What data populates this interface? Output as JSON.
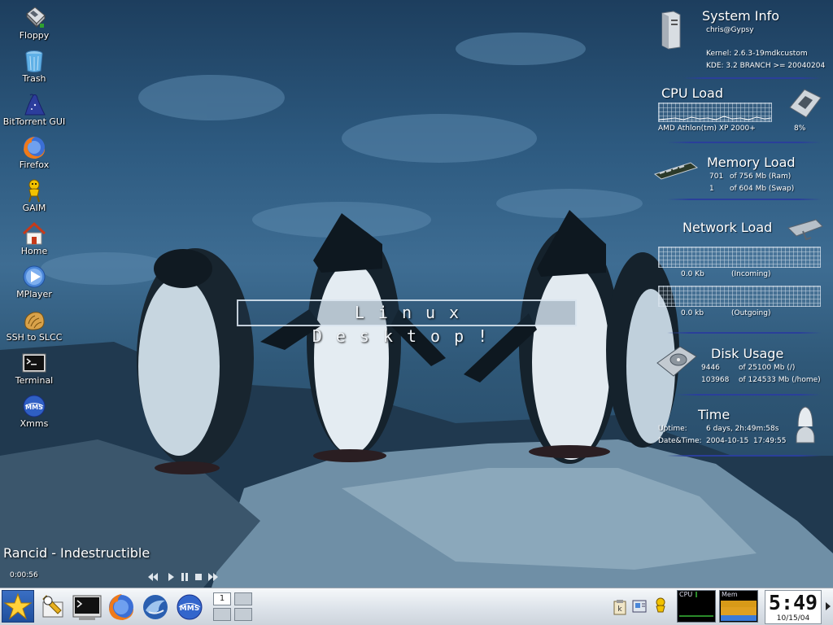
{
  "desktop": {
    "icons": [
      {
        "label": "Floppy",
        "icon": "floppy-icon"
      },
      {
        "label": "Trash",
        "icon": "trash-icon"
      },
      {
        "label": "BitTorrent GUI",
        "icon": "bittorrent-icon"
      },
      {
        "label": "Firefox",
        "icon": "firefox-icon"
      },
      {
        "label": "GAIM",
        "icon": "gaim-icon"
      },
      {
        "label": "Home",
        "icon": "home-icon"
      },
      {
        "label": "MPlayer",
        "icon": "mplayer-icon"
      },
      {
        "label": "SSH to SLCC",
        "icon": "shell-icon"
      },
      {
        "label": "Terminal",
        "icon": "terminal-icon"
      },
      {
        "label": "Xmms",
        "icon": "xmms-icon"
      }
    ],
    "banner": "Linux Desktop!"
  },
  "monitor": {
    "system": {
      "title": "System Info",
      "user": "chris@Gypsy",
      "kernel": "Kernel: 2.6.3-19mdkcustom",
      "kde": "KDE: 3.2 BRANCH >= 20040204"
    },
    "cpu": {
      "title": "CPU Load",
      "model": "AMD Athlon(tm) XP 2000+",
      "percent_text": "8%",
      "load_fraction": 0.08
    },
    "memory": {
      "title": "Memory Load",
      "ram_used": "701",
      "ram_total": "of 756 Mb (Ram)",
      "swap_used": "1",
      "swap_total": "of 604 Mb (Swap)"
    },
    "network": {
      "title": "Network Load",
      "in_value": "0.0 Kb",
      "in_label": "(Incoming)",
      "out_value": "0.0 kb",
      "out_label": "(Outgoing)"
    },
    "disk": {
      "title": "Disk Usage",
      "root_used": "9446",
      "root_total": "of 25100 Mb (/)",
      "home_used": "103968",
      "home_total": "of 124533 Mb (/home)"
    },
    "time": {
      "title": "Time",
      "uptime_label": "Uptime:",
      "uptime_value": "6 days, 2h:49m:58s",
      "datetime_label": "Date&Time:",
      "datetime_value": "2004-10-15  17:49:55"
    }
  },
  "media": {
    "now_playing": "Rancid - Indestructible",
    "elapsed": "0:00:56"
  },
  "taskbar": {
    "launchers": [
      "kmenu-star-icon",
      "editor-icon",
      "terminal-icon",
      "firefox-icon",
      "thunderbird-icon",
      "xmms-icon"
    ],
    "pager": [
      "1",
      "",
      "",
      ""
    ],
    "cpu_label": "CPU",
    "mem_label": "Mem",
    "clock_time": "5:49",
    "clock_date": "10/15/04"
  }
}
